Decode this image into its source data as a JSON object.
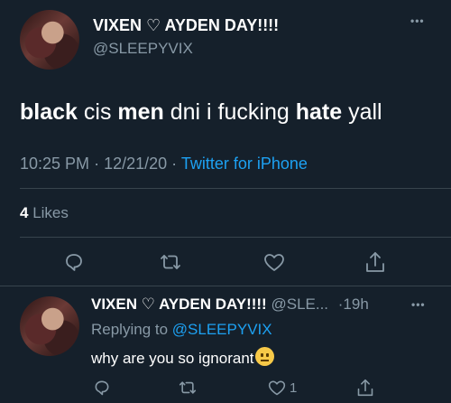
{
  "main_tweet": {
    "display_name": "VIXEN ♡ AYDEN DAY!!!!",
    "handle": "@SLEEPYVIX",
    "more_label": "•••",
    "text_segments": [
      {
        "text": "black",
        "bold": true
      },
      {
        "text": " cis ",
        "bold": false
      },
      {
        "text": "men",
        "bold": true
      },
      {
        "text": " dni i fucking ",
        "bold": false
      },
      {
        "text": "hate",
        "bold": true
      },
      {
        "text": " yall",
        "bold": false
      }
    ],
    "time": "10:25 PM",
    "date": "12/21/20",
    "separator": "·",
    "client": "Twitter for iPhone",
    "likes_count": "4",
    "likes_label": "Likes"
  },
  "reply_tweet": {
    "display_name": "VIXEN ♡ AYDEN DAY!!!!",
    "handle": "@SLE...",
    "time_ago": "·19h",
    "more_label": "•••",
    "replying_prefix": "Replying to",
    "replying_handle": "@SLEEPYVIX",
    "text": "why are you so ignorant",
    "emoji": "neutral-face",
    "like_count": "1"
  },
  "icons": [
    "reply-icon",
    "retweet-icon",
    "like-icon",
    "share-icon"
  ],
  "colors": {
    "background": "#15202b",
    "text": "#ffffff",
    "muted": "#8899a6",
    "link": "#1da1f2",
    "divider": "#38444d"
  }
}
